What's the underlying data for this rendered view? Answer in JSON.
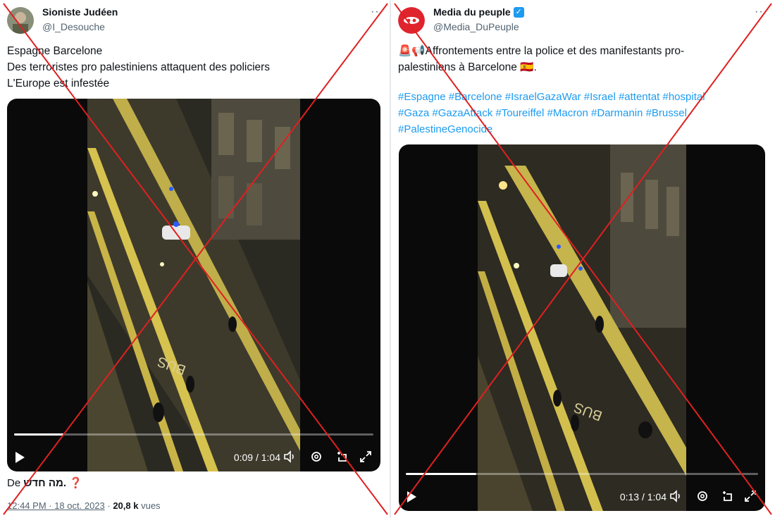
{
  "left_tweet": {
    "name": "Sioniste Judéen",
    "handle": "@I_Desouche",
    "more": "···",
    "lines": [
      "Espagne Barcelone",
      "Des terroristes pro palestiniens attaquent des policiers",
      "L'Europe est infestée"
    ],
    "video": {
      "time": "0:09 / 1:04",
      "progress": 0.14
    },
    "attribution_prefix": "De",
    "attribution_name": "מה חדש.",
    "attribution_emoji": "❓",
    "timestamp": "12:44 PM · 18 oct. 2023",
    "views_separator": " · ",
    "views_count": "20,8 k",
    "views_label": " vues"
  },
  "right_tweet": {
    "name": "Media du peuple",
    "handle": "@Media_DuPeuple",
    "more": "···",
    "emoji_prefix": "🚨📢",
    "text_line1": "Affrontements entre la police et des manifestants pro-",
    "text_line2": "palestiniens à Barcelone",
    "flag_emoji": "🇪🇸",
    "text_end": ".",
    "hashtags_line1": "#Espagne #Barcelone #IsraelGazaWar #Israel #attentat #hospital",
    "hashtags_line2": "#Gaza #GazaAttack #Toureiffel #Macron #Darmanin #Brussel",
    "hashtags_line3": "#PalestineGenocide",
    "video": {
      "time": "0:13 / 1:04",
      "progress": 0.2
    }
  },
  "colors": {
    "cross": "#e02020",
    "link": "#1d9bf0",
    "secondary_text": "#536471",
    "street_light": "#c7b860"
  }
}
